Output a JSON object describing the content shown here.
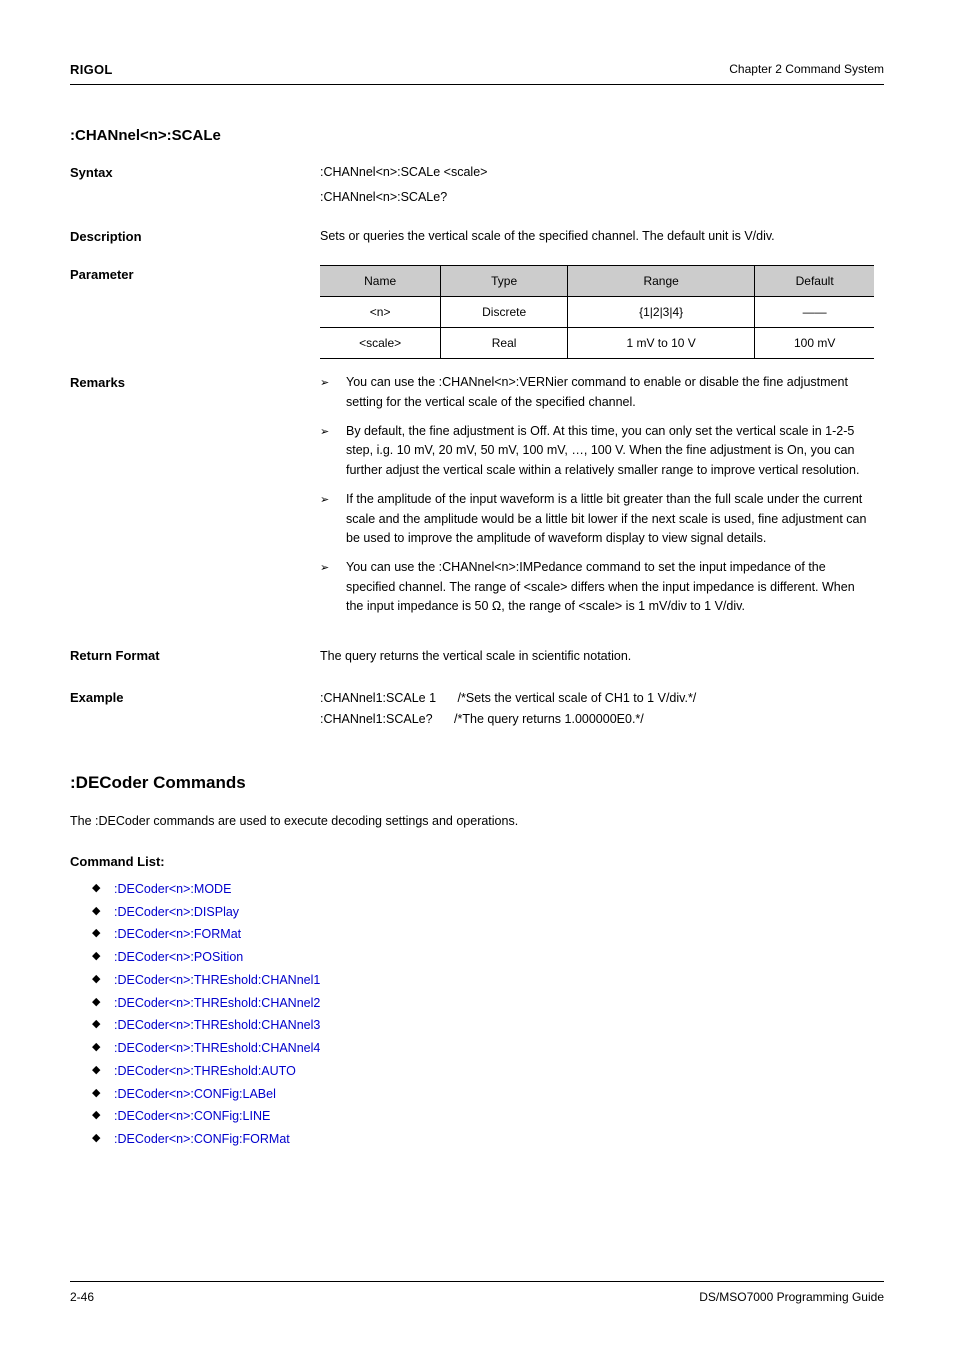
{
  "header": {
    "brand": "RIGOL",
    "chapter": "Chapter 2 Command System"
  },
  "cmd1": {
    "name": ":CHANnel<n>:SCALe",
    "syntax_labels": "Syntax",
    "syntax_set": ":CHANnel<n>:SCALe <scale>",
    "syntax_query": ":CHANnel<n>:SCALe?",
    "desc_label": "Description",
    "desc": "Sets or queries the vertical scale of the specified channel. The default unit is V/div.",
    "param_label": "Parameter",
    "table": {
      "headers": [
        "Name",
        "Type",
        "Range",
        "Default"
      ],
      "rows": [
        [
          "<n>",
          "Discrete",
          "{1|2|3|4}",
          "——"
        ],
        [
          "<scale>",
          "Real",
          "1 mV to 10 V",
          "100 mV"
        ]
      ]
    },
    "remarks_label": "Remarks",
    "remarks": [
      "You can use the :CHANnel<n>:VERNier command to enable or disable the fine adjustment setting for the vertical scale of the specified channel.",
      "By default, the fine adjustment is Off. At this time, you can only set the vertical scale in 1-2-5 step, i.g. 10 mV, 20 mV, 50 mV, 100 mV, …, 100 V. When the fine adjustment is On, you can further adjust the vertical scale within a relatively smaller range to improve vertical resolution.",
      "If the amplitude of the input waveform is a little bit greater than the full scale under the current scale and the amplitude would be a little bit lower if the next scale is used, fine adjustment can be used to improve the amplitude of waveform display to view signal details.",
      "You can use the :CHANnel<n>:IMPedance command to set the input impedance of the specified channel. The range of <scale> differs when the input impedance is different. When the input impedance is 50 Ω, the range of <scale> is 1 mV/div to 1 V/div."
    ],
    "return_label": "Return Format",
    "return": "The query returns the vertical scale in scientific notation.",
    "example_label": "Example",
    "example_lines": [
      {
        "cmd": ":CHANnel1:SCALe 1",
        "comment": "/*Sets the vertical scale of CH1 to 1 V/div.*/"
      },
      {
        "cmd": ":CHANnel1:SCALe?",
        "comment": "/*The query returns 1.000000E0.*/"
      }
    ]
  },
  "section_decode": {
    "title": ":DECoder Commands",
    "intro": "The :DECoder commands are used to execute decoding settings and operations.",
    "cmdlist_label": "Command List:",
    "items": [
      ":DECoder<n>:MODE",
      ":DECoder<n>:DISPlay",
      ":DECoder<n>:FORMat",
      ":DECoder<n>:POSition",
      ":DECoder<n>:THREshold:CHANnel1",
      ":DECoder<n>:THREshold:CHANnel2",
      ":DECoder<n>:THREshold:CHANnel3",
      ":DECoder<n>:THREshold:CHANnel4",
      ":DECoder<n>:THREshold:AUTO",
      ":DECoder<n>:CONFig:LABel",
      ":DECoder<n>:CONFig:LINE",
      ":DECoder<n>:CONFig:FORMat"
    ]
  },
  "footer": {
    "page": "2-46",
    "doc": "DS/MSO7000 Programming Guide"
  }
}
